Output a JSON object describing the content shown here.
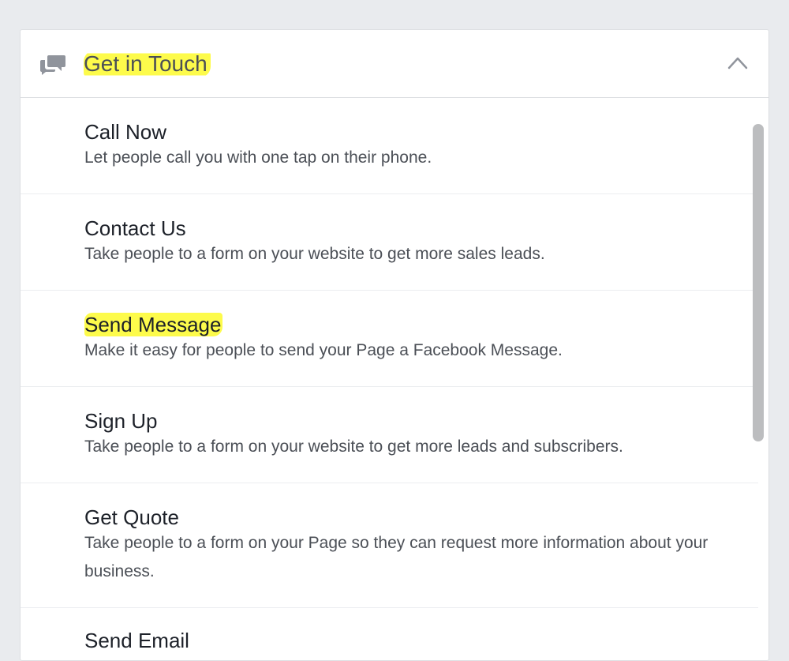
{
  "panel": {
    "header": {
      "title": "Get in Touch",
      "icon": "chat-bubbles-icon",
      "toggle_icon": "chevron-up-icon"
    },
    "options": [
      {
        "title": "Call Now",
        "description": "Let people call you with one tap on their phone."
      },
      {
        "title": "Contact Us",
        "description": "Take people to a form on your website to get more sales leads."
      },
      {
        "title": "Send Message",
        "description": "Make it easy for people to send your Page a Facebook Message."
      },
      {
        "title": "Sign Up",
        "description": "Take people to a form on your website to get more leads and subscribers."
      },
      {
        "title": "Get Quote",
        "description": "Take people to a form on your Page so they can request more information about your business."
      },
      {
        "title": "Send Email",
        "description": ""
      }
    ]
  },
  "colors": {
    "highlight": "#fdfb4b",
    "background": "#e9ebee",
    "panel": "#ffffff",
    "title_text": "#1d2129",
    "description_text": "#4b4f56",
    "icon": "#90949c"
  }
}
